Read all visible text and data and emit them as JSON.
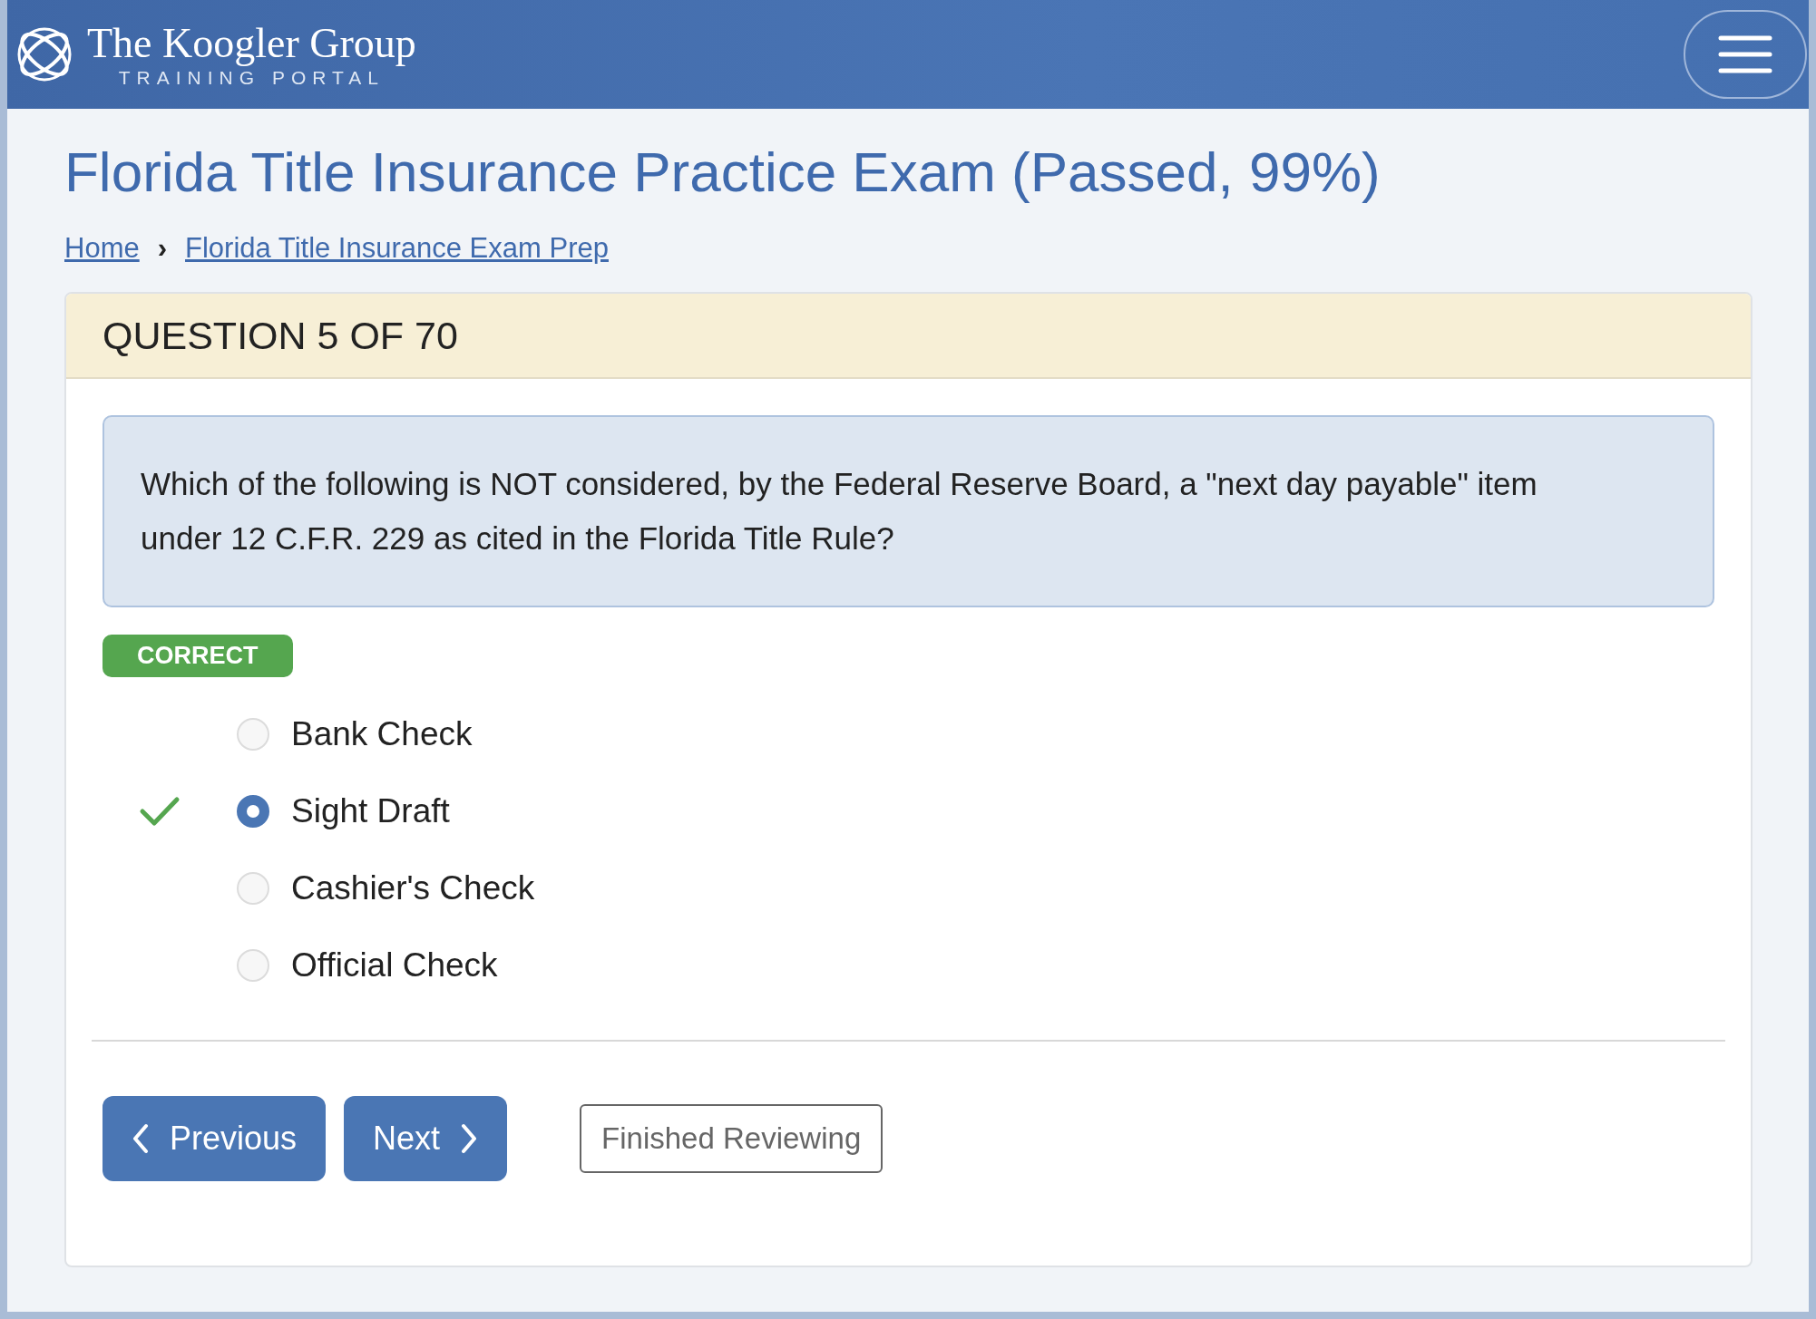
{
  "header": {
    "logo_title": "The Koogler Group",
    "logo_subtitle": "TRAINING PORTAL"
  },
  "page_title": "Florida Title Insurance Practice Exam (Passed, 99%)",
  "breadcrumbs": [
    {
      "label": "Home"
    },
    {
      "label": "Florida Title Insurance Exam Prep"
    }
  ],
  "breadcrumb_separator": "›",
  "question": {
    "heading": "QUESTION 5 OF 70",
    "text": "Which of the following is NOT considered, by the Federal Reserve Board, a \"next day payable\" item under 12 C.F.R. 229 as cited in the Florida Title Rule?",
    "result": {
      "label": "CORRECT",
      "kind": "correct"
    },
    "options": [
      {
        "label": "Bank Check",
        "selected": false,
        "correct": false
      },
      {
        "label": "Sight Draft",
        "selected": true,
        "correct": true
      },
      {
        "label": "Cashier's Check",
        "selected": false,
        "correct": false
      },
      {
        "label": "Official Check",
        "selected": false,
        "correct": false
      }
    ]
  },
  "buttons": {
    "previous": "Previous",
    "next": "Next",
    "finish": "Finished Reviewing"
  }
}
